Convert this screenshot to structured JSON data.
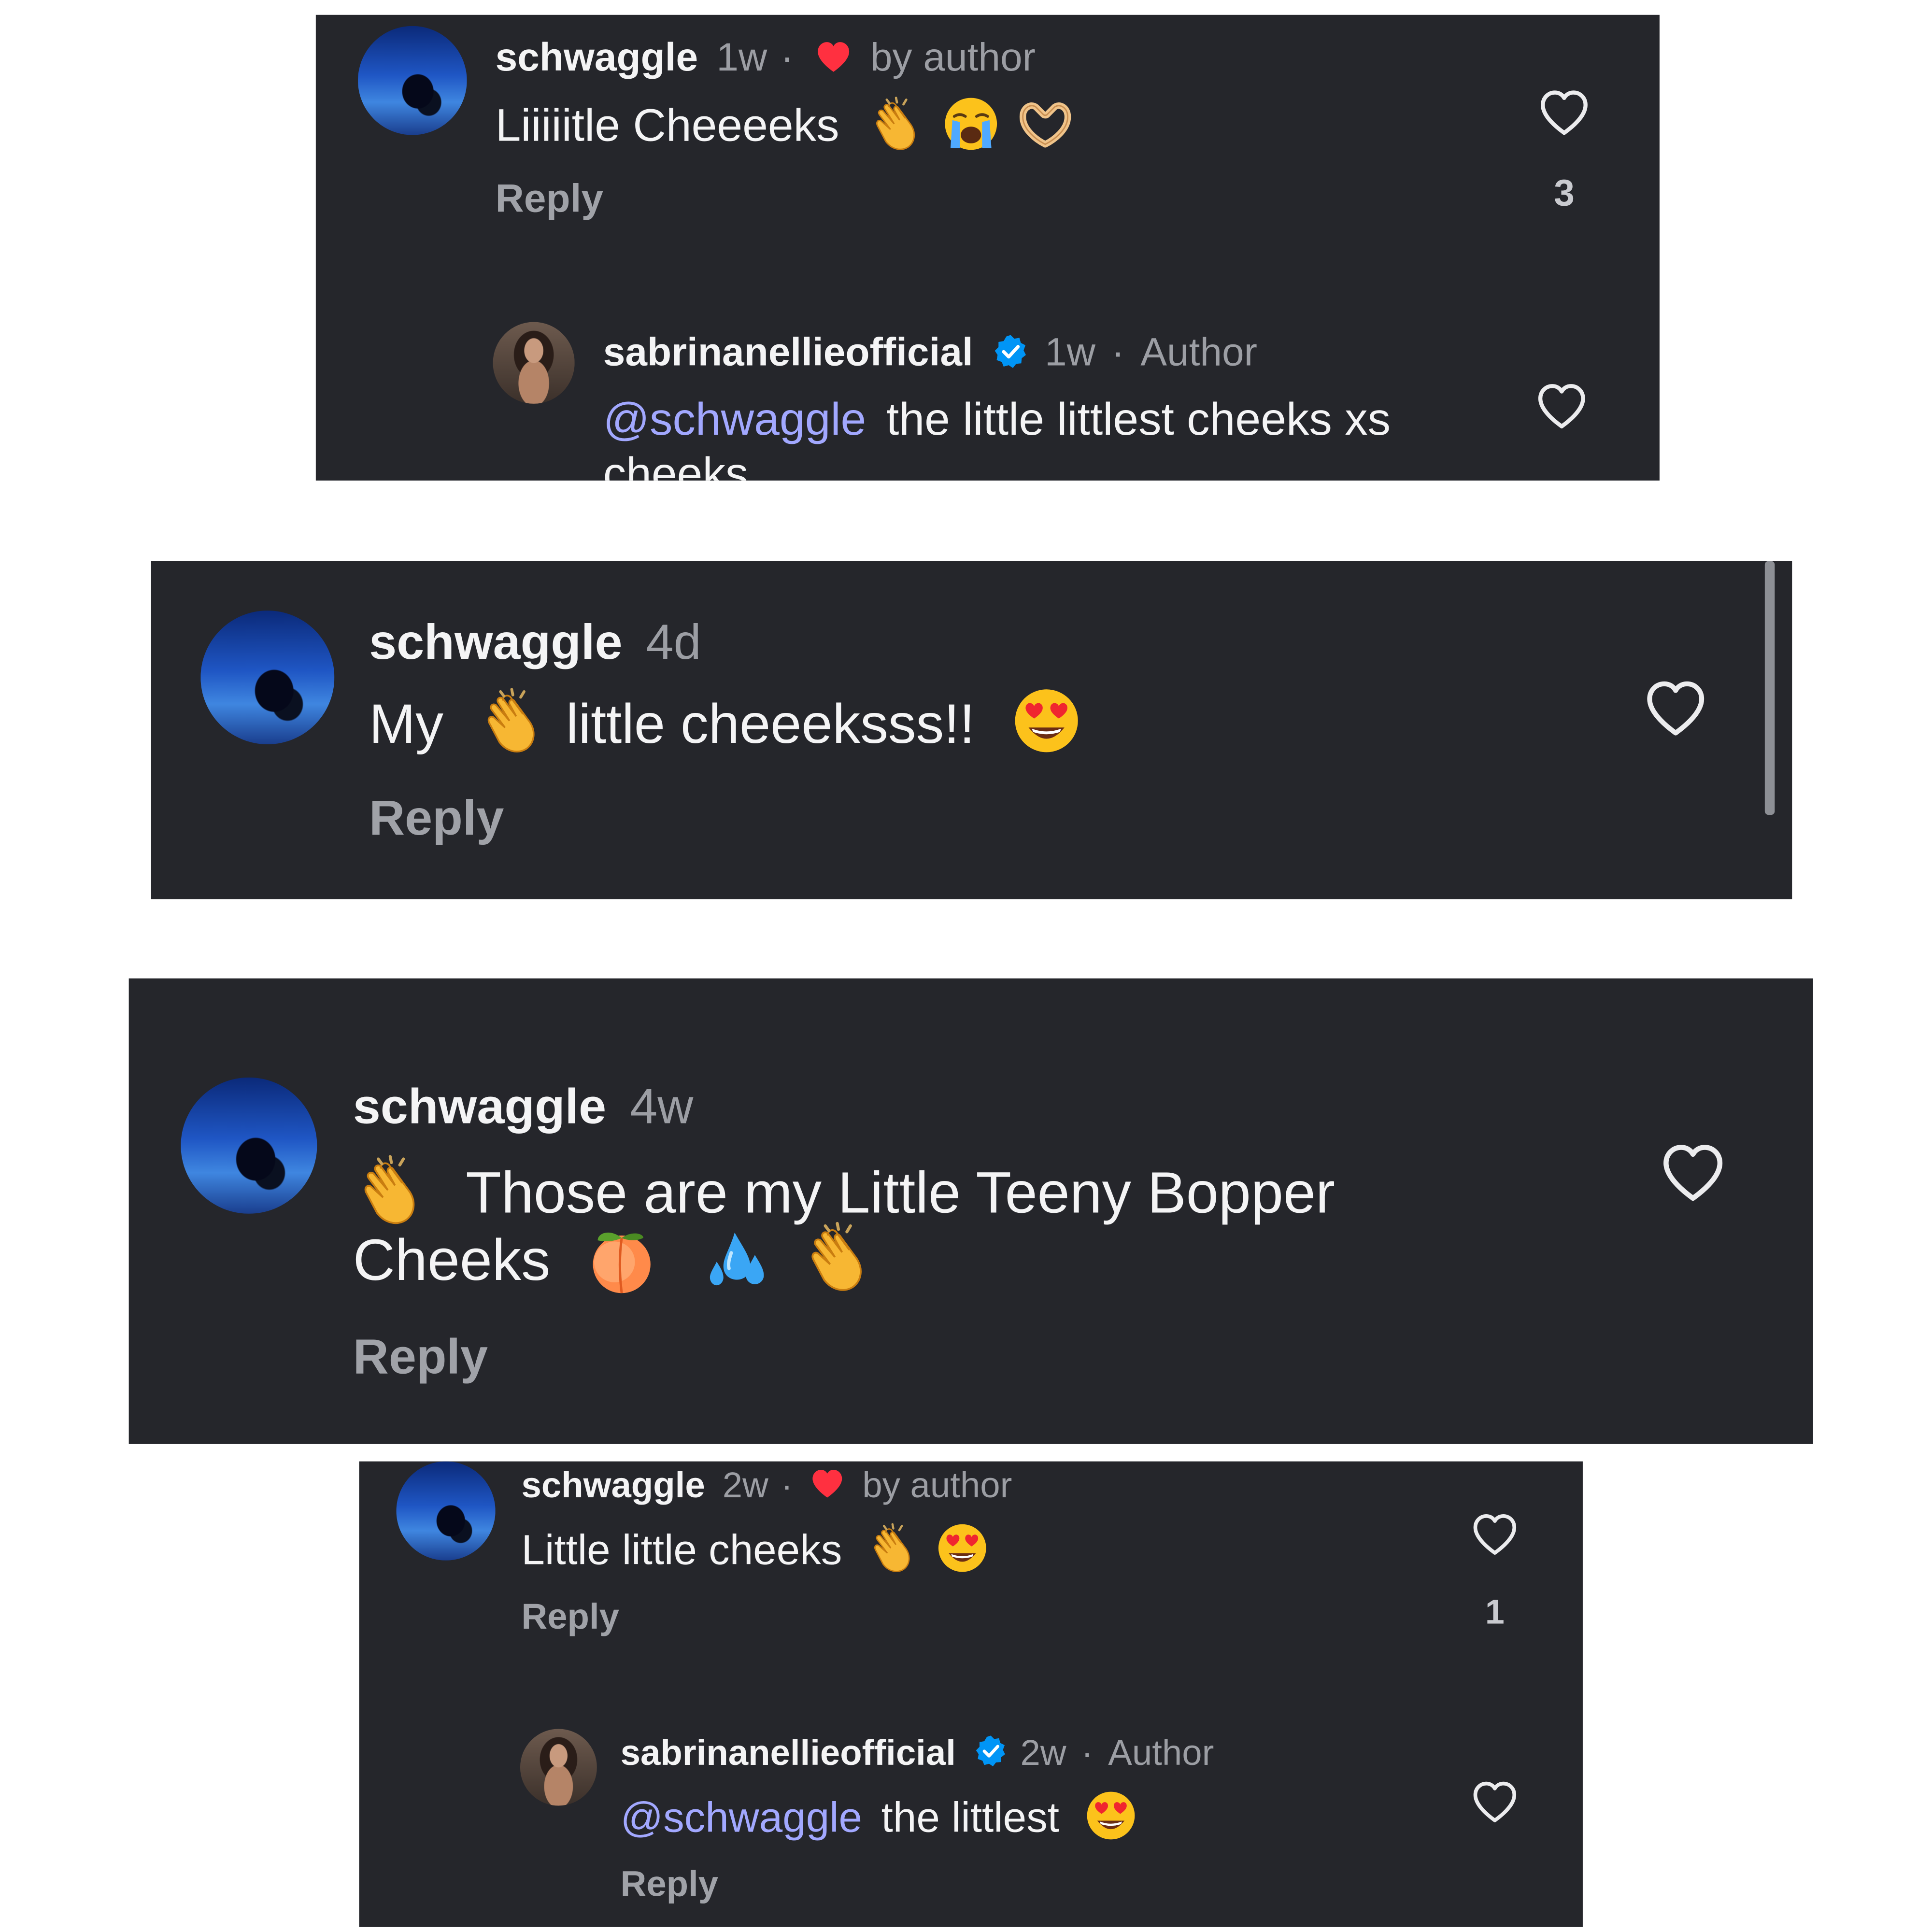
{
  "colors": {
    "panel_bg": "#25262b",
    "username": "#f4f4f5",
    "meta": "#9c9ea4",
    "mention": "#a2a8ff",
    "liked_heart": "#ff3040",
    "verified_badge": "#0095f6"
  },
  "icons": {
    "like": "heart-outline-icon",
    "liked_by_author": "heart-filled-icon",
    "verified": "verified-badge-icon",
    "clap": "clapping-hands-emoji",
    "crying": "loudly-crying-face-emoji",
    "heart_hands": "heart-hands-emoji",
    "heart_eyes": "smiling-face-with-heart-eyes-emoji",
    "peach": "peach-emoji",
    "sweat_droplets": "sweat-droplets-emoji"
  },
  "panel1": {
    "comment": {
      "username": "schwaggle",
      "time": "1w",
      "dot": "·",
      "by_author": "by author",
      "text": "Liiiiitle Cheeeeks",
      "reply": "Reply",
      "like_count": "3"
    },
    "reply": {
      "username": "sabrinanellieofficial",
      "time": "1w",
      "dot": "·",
      "author_label": "Author",
      "mention": "@schwaggle",
      "text": "the little littlest cheeks xs",
      "text_line2": "cheeks"
    }
  },
  "panel2": {
    "comment": {
      "username": "schwaggle",
      "time": "4d",
      "text_before": "My",
      "text_after": "little cheeeksss!!",
      "reply": "Reply"
    }
  },
  "panel3": {
    "comment": {
      "username": "schwaggle",
      "time": "4w",
      "text_line1": "Those are my Little Teeny Bopper",
      "text_line2": "Cheeks",
      "reply": "Reply"
    }
  },
  "panel4": {
    "comment": {
      "username": "schwaggle",
      "time": "2w",
      "dot": "·",
      "by_author": "by author",
      "text": "Little little cheeks",
      "reply": "Reply",
      "like_count": "1"
    },
    "reply": {
      "username": "sabrinanellieofficial",
      "time": "2w",
      "dot": "·",
      "author_label": "Author",
      "mention": "@schwaggle",
      "text": "the littlest",
      "reply": "Reply"
    }
  }
}
